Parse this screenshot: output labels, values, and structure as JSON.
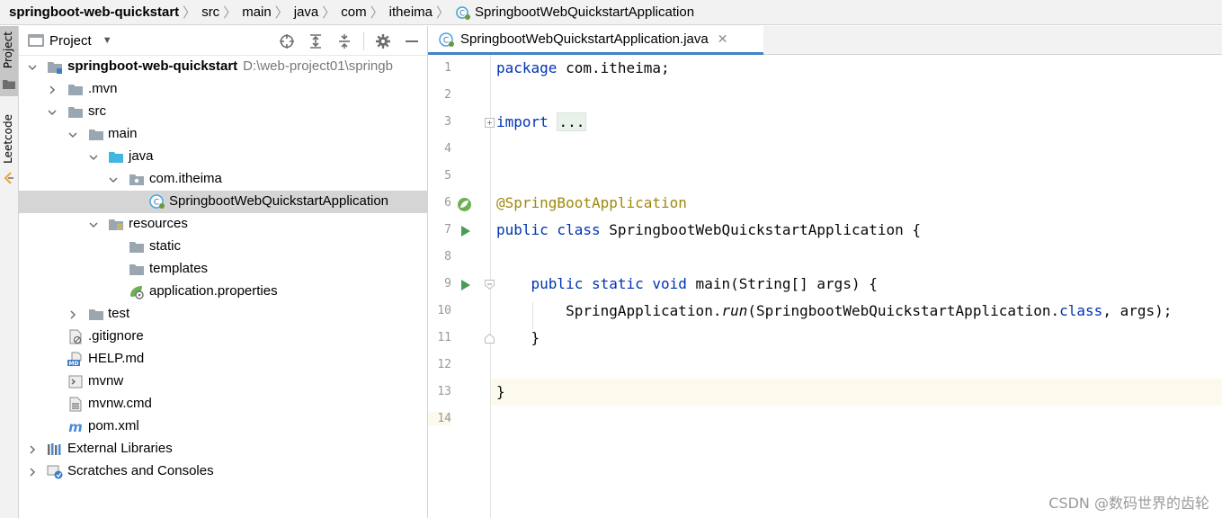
{
  "breadcrumb": {
    "items": [
      "springboot-web-quickstart",
      "src",
      "main",
      "java",
      "com",
      "itheima",
      "SpringbootWebQuickstartApplication"
    ]
  },
  "toolstrip": {
    "project_label": "Project",
    "leetcode_label": "Leetcode"
  },
  "project_panel": {
    "title": "Project",
    "tree": {
      "root_name": "springboot-web-quickstart",
      "root_path": "D:\\web-project01\\springb",
      "mvn": ".mvn",
      "src": "src",
      "main": "main",
      "java": "java",
      "package": "com.itheima",
      "app_class": "SpringbootWebQuickstartApplication",
      "resources": "resources",
      "static": "static",
      "templates": "templates",
      "app_props": "application.properties",
      "test": "test",
      "gitignore": ".gitignore",
      "help": "HELP.md",
      "mvnw": "mvnw",
      "mvnw_cmd": "mvnw.cmd",
      "pom": "pom.xml",
      "ext_libs": "External Libraries",
      "scratches": "Scratches and Consoles"
    }
  },
  "editor": {
    "tab_label": "SpringbootWebQuickstartApplication.java",
    "line_numbers": [
      "1",
      "2",
      "3",
      "4",
      "5",
      "6",
      "7",
      "8",
      "9",
      "10",
      "11",
      "12",
      "13",
      "14"
    ],
    "code": {
      "l1_kw": "package",
      "l1_rest": " com.itheima;",
      "l3_kw": "import",
      "l3_fold": "...",
      "l6_ann": "@SpringBootApplication",
      "l7_kw": "public class",
      "l7_rest": " SpringbootWebQuickstartApplication {",
      "l9_kw": "public static void",
      "l9_rest": " main(String[] args) {",
      "l10_a": "SpringApplication.",
      "l10_run": "run",
      "l10_b": "(SpringbootWebQuickstartApplication.",
      "l10_kw": "class",
      "l10_c": ", args);",
      "l11": "}",
      "l13": "}"
    }
  },
  "watermark": "CSDN @数码世界的齿轮",
  "colors": {
    "keyword": "#0033b3",
    "annotation": "#9e880d",
    "selection": "#d5d5d5",
    "tab_underline": "#4083c9",
    "current_line": "#fcfaed"
  }
}
